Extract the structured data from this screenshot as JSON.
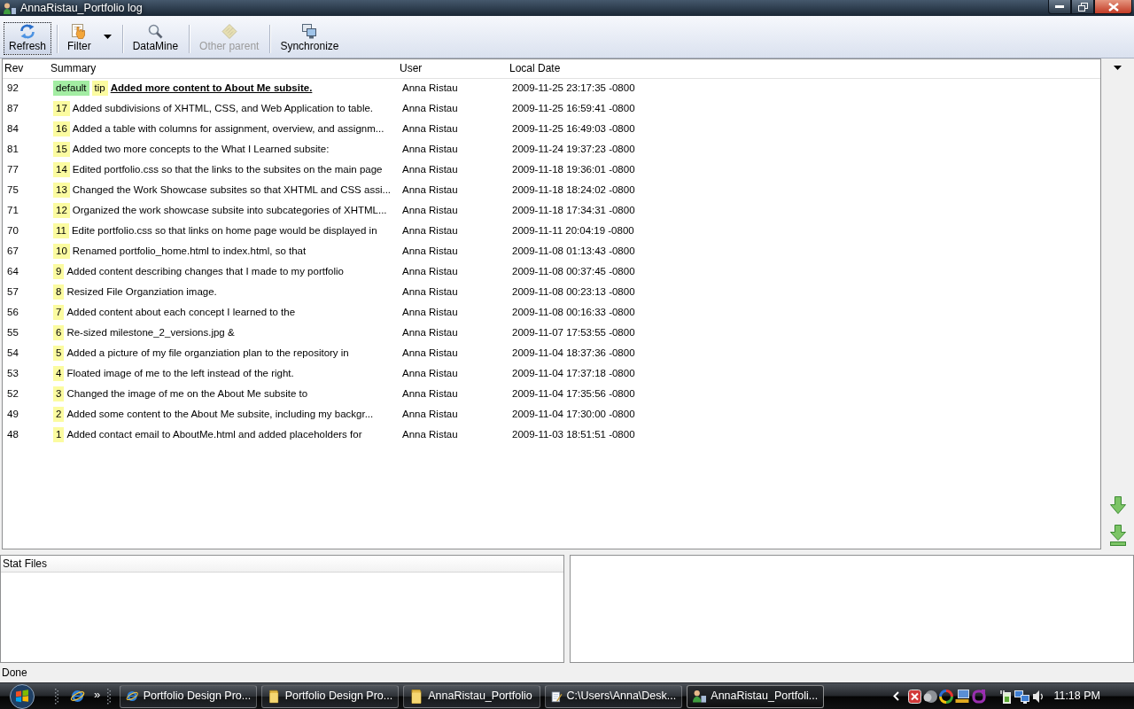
{
  "window": {
    "title": "AnnaRistau_Portfolio log"
  },
  "toolbar": [
    {
      "label": "Refresh",
      "kind": "button",
      "focused": true,
      "disabled": false
    },
    {
      "label": "Filter",
      "kind": "dropdown",
      "focused": false,
      "disabled": false
    },
    {
      "label": "DataMine",
      "kind": "button",
      "focused": false,
      "disabled": false
    },
    {
      "label": "Other parent",
      "kind": "button",
      "focused": false,
      "disabled": true
    },
    {
      "label": "Synchronize",
      "kind": "button",
      "focused": false,
      "disabled": false
    }
  ],
  "table": {
    "columns": [
      "Rev",
      "Summary",
      "User",
      "Local Date"
    ],
    "rows": [
      {
        "rev": "92",
        "tags": [
          {
            "label": "default",
            "color": "#a3eda3"
          },
          {
            "label": "tip",
            "color": "#fbfba0"
          }
        ],
        "summary": "Added more content to About Me subsite.",
        "current": true,
        "user": "Anna Ristau",
        "date": "2009-11-25 23:17:35 -0800"
      },
      {
        "rev": "87",
        "tags": [
          {
            "label": "17",
            "color": "#fbfba0"
          }
        ],
        "summary": "Added subdivisions of XHTML, CSS, and Web Application to table.",
        "current": false,
        "user": "Anna Ristau",
        "date": "2009-11-25 16:59:41 -0800"
      },
      {
        "rev": "84",
        "tags": [
          {
            "label": "16",
            "color": "#fbfba0"
          }
        ],
        "summary": "Added a table with columns for assignment, overview, and assignm...",
        "current": false,
        "user": "Anna Ristau",
        "date": "2009-11-25 16:49:03 -0800"
      },
      {
        "rev": "81",
        "tags": [
          {
            "label": "15",
            "color": "#fbfba0"
          }
        ],
        "summary": "Added two more concepts to the What I Learned subsite:",
        "current": false,
        "user": "Anna Ristau",
        "date": "2009-11-24 19:37:23 -0800"
      },
      {
        "rev": "77",
        "tags": [
          {
            "label": "14",
            "color": "#fbfba0"
          }
        ],
        "summary": "Edited portfolio.css so that the links to the subsites on the main page",
        "current": false,
        "user": "Anna Ristau",
        "date": "2009-11-18 19:36:01 -0800"
      },
      {
        "rev": "75",
        "tags": [
          {
            "label": "13",
            "color": "#fbfba0"
          }
        ],
        "summary": "Changed the Work Showcase subsites so that XHTML and CSS assi...",
        "current": false,
        "user": "Anna Ristau",
        "date": "2009-11-18 18:24:02 -0800"
      },
      {
        "rev": "71",
        "tags": [
          {
            "label": "12",
            "color": "#fbfba0"
          }
        ],
        "summary": "Organized the work showcase subsite into subcategories of XHTML...",
        "current": false,
        "user": "Anna Ristau",
        "date": "2009-11-18 17:34:31 -0800"
      },
      {
        "rev": "70",
        "tags": [
          {
            "label": "11",
            "color": "#fbfba0"
          }
        ],
        "summary": "Edite portfolio.css so that links on home page would be displayed in",
        "current": false,
        "user": "Anna Ristau",
        "date": "2009-11-11 20:04:19 -0800"
      },
      {
        "rev": "67",
        "tags": [
          {
            "label": "10",
            "color": "#fbfba0"
          }
        ],
        "summary": "Renamed portfolio_home.html to index.html, so that",
        "current": false,
        "user": "Anna Ristau",
        "date": "2009-11-08 01:13:43 -0800"
      },
      {
        "rev": "64",
        "tags": [
          {
            "label": "9",
            "color": "#fbfba0"
          }
        ],
        "summary": "Added content describing changes that I made to my portfolio",
        "current": false,
        "user": "Anna Ristau",
        "date": "2009-11-08 00:37:45 -0800"
      },
      {
        "rev": "57",
        "tags": [
          {
            "label": "8",
            "color": "#fbfba0"
          }
        ],
        "summary": "Resized File Organziation image.",
        "current": false,
        "user": "Anna Ristau",
        "date": "2009-11-08 00:23:13 -0800"
      },
      {
        "rev": "56",
        "tags": [
          {
            "label": "7",
            "color": "#fbfba0"
          }
        ],
        "summary": "Added content about each concept I learned to the",
        "current": false,
        "user": "Anna Ristau",
        "date": "2009-11-08 00:16:33 -0800"
      },
      {
        "rev": "55",
        "tags": [
          {
            "label": "6",
            "color": "#fbfba0"
          }
        ],
        "summary": "Re-sized milestone_2_versions.jpg &",
        "current": false,
        "user": "Anna Ristau",
        "date": "2009-11-07 17:53:55 -0800"
      },
      {
        "rev": "54",
        "tags": [
          {
            "label": "5",
            "color": "#fbfba0"
          }
        ],
        "summary": "Added a picture of my file organziation plan to the repository in",
        "current": false,
        "user": "Anna Ristau",
        "date": "2009-11-04 18:37:36 -0800"
      },
      {
        "rev": "53",
        "tags": [
          {
            "label": "4",
            "color": "#fbfba0"
          }
        ],
        "summary": "Floated image of me to the left instead of the right.",
        "current": false,
        "user": "Anna Ristau",
        "date": "2009-11-04 17:37:18 -0800"
      },
      {
        "rev": "52",
        "tags": [
          {
            "label": "3",
            "color": "#fbfba0"
          }
        ],
        "summary": "Changed the image of me on the About Me subsite to",
        "current": false,
        "user": "Anna Ristau",
        "date": "2009-11-04 17:35:56 -0800"
      },
      {
        "rev": "49",
        "tags": [
          {
            "label": "2",
            "color": "#fbfba0"
          }
        ],
        "summary": "Added some content to the About Me subsite, including my backgr...",
        "current": false,
        "user": "Anna Ristau",
        "date": "2009-11-04 17:30:00 -0800"
      },
      {
        "rev": "48",
        "tags": [
          {
            "label": "1",
            "color": "#fbfba0"
          }
        ],
        "summary": "Added contact email to AboutMe.html and added placeholders for",
        "current": false,
        "user": "Anna Ristau",
        "date": "2009-11-03 18:51:51 -0800"
      }
    ]
  },
  "stat_files": {
    "title": "Stat Files"
  },
  "status_bar": {
    "text": "Done"
  },
  "taskbar": {
    "more": "»",
    "tasks": [
      {
        "label": "Portfolio Design Pro...",
        "kind": "browser",
        "selected": false
      },
      {
        "label": "Portfolio Design Pro...",
        "kind": "folder",
        "selected": false
      },
      {
        "label": "AnnaRistau_Portfolio",
        "kind": "folder",
        "selected": false
      },
      {
        "label": "C:\\Users\\Anna\\Desk...",
        "kind": "notepad",
        "selected": false
      },
      {
        "label": "AnnaRistau_Portfoli...",
        "kind": "app",
        "selected": true
      }
    ],
    "clock": "11:18 PM"
  }
}
